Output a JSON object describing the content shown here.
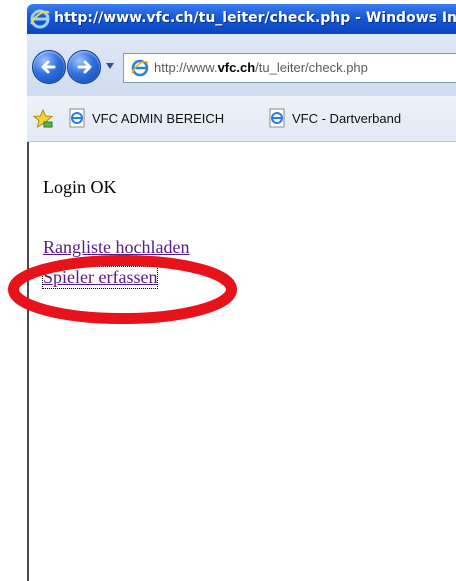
{
  "window": {
    "title": "http://www.vfc.ch/tu_leiter/check.php - Windows Internet Explorer"
  },
  "navigation": {
    "url_prefix": "http://www.",
    "url_domain": "vfc.ch",
    "url_path": "/tu_leiter/check.php"
  },
  "favorites": {
    "items": [
      {
        "label": "VFC ADMIN BEREICH"
      },
      {
        "label": "VFC - Dartverband"
      }
    ]
  },
  "page": {
    "status": "Login OK",
    "links": [
      {
        "label": "Rangliste hochladen"
      },
      {
        "label": "Spieler erfassen"
      }
    ]
  },
  "colors": {
    "titlebar": "#1658d6",
    "visited_link": "#551a8b",
    "annotation_circle": "#e8121a"
  },
  "icons": [
    "ie-icon",
    "back-arrow-icon",
    "forward-arrow-icon",
    "chevron-down-icon",
    "ie-page-icon",
    "favorites-star-icon"
  ]
}
